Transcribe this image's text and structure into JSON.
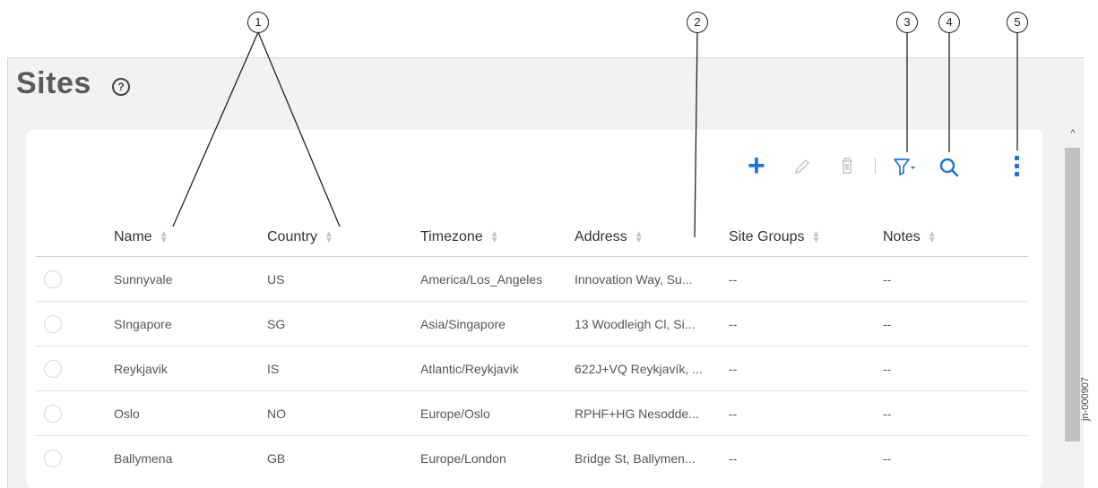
{
  "page": {
    "title": "Sites",
    "help_icon": "?",
    "figure_id": "jn-000907"
  },
  "toolbar": {
    "add_icon": "+",
    "edit_icon": "pencil-icon",
    "delete_icon": "trash-icon",
    "filter_icon": "filter-icon",
    "search_icon": "search-icon",
    "more_icon": "kebab-menu-icon",
    "accent_color": "#1a73d9"
  },
  "table": {
    "columns": [
      "Name",
      "Country",
      "Timezone",
      "Address",
      "Site Groups",
      "Notes"
    ],
    "rows": [
      {
        "name": "Sunnyvale",
        "country": "US",
        "timezone": "America/Los_Angeles",
        "address": "Innovation Way, Su...",
        "site_groups": "--",
        "notes": "--"
      },
      {
        "name": "SIngapore",
        "country": "SG",
        "timezone": "Asia/Singapore",
        "address": "13 Woodleigh Cl, Si...",
        "site_groups": "--",
        "notes": "--"
      },
      {
        "name": "Reykjavik",
        "country": "IS",
        "timezone": "Atlantic/Reykjavik",
        "address": "622J+VQ Reykjavík, ...",
        "site_groups": "--",
        "notes": "--"
      },
      {
        "name": "Oslo",
        "country": "NO",
        "timezone": "Europe/Oslo",
        "address": "RPHF+HG Nesodde...",
        "site_groups": "--",
        "notes": "--"
      },
      {
        "name": "Ballymena",
        "country": "GB",
        "timezone": "Europe/London",
        "address": "Bridge St, Ballymen...",
        "site_groups": "--",
        "notes": "--"
      }
    ]
  },
  "callouts": [
    "1",
    "2",
    "3",
    "4",
    "5"
  ]
}
